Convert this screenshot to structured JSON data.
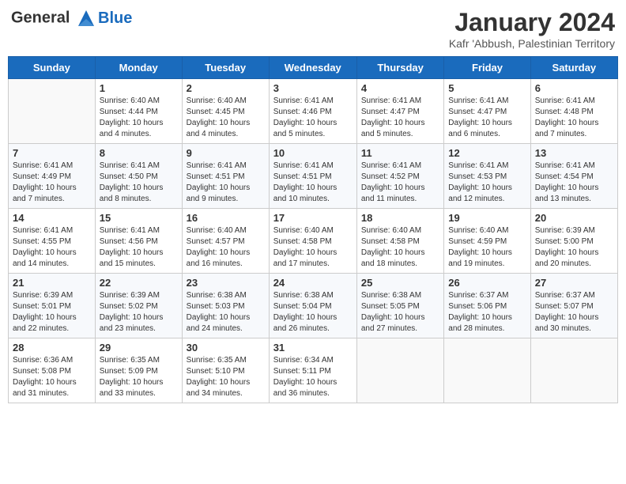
{
  "header": {
    "logo_line1": "General",
    "logo_line2": "Blue",
    "month_title": "January 2024",
    "location": "Kafr 'Abbush, Palestinian Territory"
  },
  "weekdays": [
    "Sunday",
    "Monday",
    "Tuesday",
    "Wednesday",
    "Thursday",
    "Friday",
    "Saturday"
  ],
  "weeks": [
    [
      {
        "day": "",
        "info": ""
      },
      {
        "day": "1",
        "info": "Sunrise: 6:40 AM\nSunset: 4:44 PM\nDaylight: 10 hours\nand 4 minutes."
      },
      {
        "day": "2",
        "info": "Sunrise: 6:40 AM\nSunset: 4:45 PM\nDaylight: 10 hours\nand 4 minutes."
      },
      {
        "day": "3",
        "info": "Sunrise: 6:41 AM\nSunset: 4:46 PM\nDaylight: 10 hours\nand 5 minutes."
      },
      {
        "day": "4",
        "info": "Sunrise: 6:41 AM\nSunset: 4:47 PM\nDaylight: 10 hours\nand 5 minutes."
      },
      {
        "day": "5",
        "info": "Sunrise: 6:41 AM\nSunset: 4:47 PM\nDaylight: 10 hours\nand 6 minutes."
      },
      {
        "day": "6",
        "info": "Sunrise: 6:41 AM\nSunset: 4:48 PM\nDaylight: 10 hours\nand 7 minutes."
      }
    ],
    [
      {
        "day": "7",
        "info": "Sunrise: 6:41 AM\nSunset: 4:49 PM\nDaylight: 10 hours\nand 7 minutes."
      },
      {
        "day": "8",
        "info": "Sunrise: 6:41 AM\nSunset: 4:50 PM\nDaylight: 10 hours\nand 8 minutes."
      },
      {
        "day": "9",
        "info": "Sunrise: 6:41 AM\nSunset: 4:51 PM\nDaylight: 10 hours\nand 9 minutes."
      },
      {
        "day": "10",
        "info": "Sunrise: 6:41 AM\nSunset: 4:51 PM\nDaylight: 10 hours\nand 10 minutes."
      },
      {
        "day": "11",
        "info": "Sunrise: 6:41 AM\nSunset: 4:52 PM\nDaylight: 10 hours\nand 11 minutes."
      },
      {
        "day": "12",
        "info": "Sunrise: 6:41 AM\nSunset: 4:53 PM\nDaylight: 10 hours\nand 12 minutes."
      },
      {
        "day": "13",
        "info": "Sunrise: 6:41 AM\nSunset: 4:54 PM\nDaylight: 10 hours\nand 13 minutes."
      }
    ],
    [
      {
        "day": "14",
        "info": "Sunrise: 6:41 AM\nSunset: 4:55 PM\nDaylight: 10 hours\nand 14 minutes."
      },
      {
        "day": "15",
        "info": "Sunrise: 6:41 AM\nSunset: 4:56 PM\nDaylight: 10 hours\nand 15 minutes."
      },
      {
        "day": "16",
        "info": "Sunrise: 6:40 AM\nSunset: 4:57 PM\nDaylight: 10 hours\nand 16 minutes."
      },
      {
        "day": "17",
        "info": "Sunrise: 6:40 AM\nSunset: 4:58 PM\nDaylight: 10 hours\nand 17 minutes."
      },
      {
        "day": "18",
        "info": "Sunrise: 6:40 AM\nSunset: 4:58 PM\nDaylight: 10 hours\nand 18 minutes."
      },
      {
        "day": "19",
        "info": "Sunrise: 6:40 AM\nSunset: 4:59 PM\nDaylight: 10 hours\nand 19 minutes."
      },
      {
        "day": "20",
        "info": "Sunrise: 6:39 AM\nSunset: 5:00 PM\nDaylight: 10 hours\nand 20 minutes."
      }
    ],
    [
      {
        "day": "21",
        "info": "Sunrise: 6:39 AM\nSunset: 5:01 PM\nDaylight: 10 hours\nand 22 minutes."
      },
      {
        "day": "22",
        "info": "Sunrise: 6:39 AM\nSunset: 5:02 PM\nDaylight: 10 hours\nand 23 minutes."
      },
      {
        "day": "23",
        "info": "Sunrise: 6:38 AM\nSunset: 5:03 PM\nDaylight: 10 hours\nand 24 minutes."
      },
      {
        "day": "24",
        "info": "Sunrise: 6:38 AM\nSunset: 5:04 PM\nDaylight: 10 hours\nand 26 minutes."
      },
      {
        "day": "25",
        "info": "Sunrise: 6:38 AM\nSunset: 5:05 PM\nDaylight: 10 hours\nand 27 minutes."
      },
      {
        "day": "26",
        "info": "Sunrise: 6:37 AM\nSunset: 5:06 PM\nDaylight: 10 hours\nand 28 minutes."
      },
      {
        "day": "27",
        "info": "Sunrise: 6:37 AM\nSunset: 5:07 PM\nDaylight: 10 hours\nand 30 minutes."
      }
    ],
    [
      {
        "day": "28",
        "info": "Sunrise: 6:36 AM\nSunset: 5:08 PM\nDaylight: 10 hours\nand 31 minutes."
      },
      {
        "day": "29",
        "info": "Sunrise: 6:35 AM\nSunset: 5:09 PM\nDaylight: 10 hours\nand 33 minutes."
      },
      {
        "day": "30",
        "info": "Sunrise: 6:35 AM\nSunset: 5:10 PM\nDaylight: 10 hours\nand 34 minutes."
      },
      {
        "day": "31",
        "info": "Sunrise: 6:34 AM\nSunset: 5:11 PM\nDaylight: 10 hours\nand 36 minutes."
      },
      {
        "day": "",
        "info": ""
      },
      {
        "day": "",
        "info": ""
      },
      {
        "day": "",
        "info": ""
      }
    ]
  ]
}
